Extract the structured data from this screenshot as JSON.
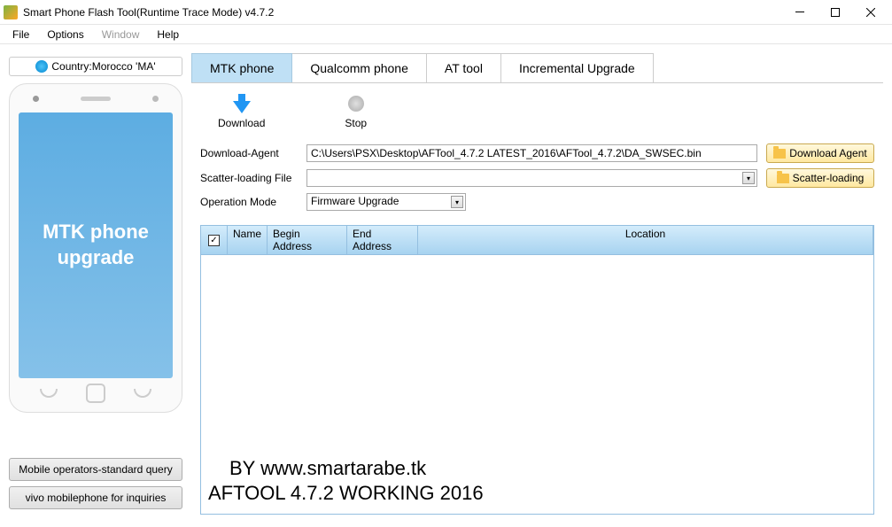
{
  "title": "Smart Phone Flash Tool(Runtime Trace Mode)  v4.7.2",
  "menu": {
    "file": "File",
    "options": "Options",
    "window": "Window",
    "help": "Help"
  },
  "country": "Country:Morocco 'MA'",
  "phone_screen": "MTK phone upgrade",
  "left_buttons": {
    "operators": "Mobile operators-standard query",
    "vivo": "vivo mobilephone for inquiries"
  },
  "tabs": {
    "mtk": "MTK phone",
    "qualcomm": "Qualcomm phone",
    "at": "AT tool",
    "incremental": "Incremental Upgrade"
  },
  "toolbar": {
    "download": "Download",
    "stop": "Stop"
  },
  "form": {
    "download_agent_label": "Download-Agent",
    "download_agent_value": "C:\\Users\\PSX\\Desktop\\AFTool_4.7.2 LATEST_2016\\AFTool_4.7.2\\DA_SWSEC.bin",
    "download_agent_btn": "Download Agent",
    "scatter_label": "Scatter-loading File",
    "scatter_value": "",
    "scatter_btn": "Scatter-loading",
    "operation_label": "Operation Mode",
    "operation_value": "Firmware Upgrade"
  },
  "grid": {
    "col_name": "Name",
    "col_begin": "Begin Address",
    "col_end": "End Address",
    "col_location": "Location"
  },
  "watermark": {
    "line1": "BY www.smartarabe.tk",
    "line2": "AFTOOL 4.7.2 WORKING 2016"
  }
}
